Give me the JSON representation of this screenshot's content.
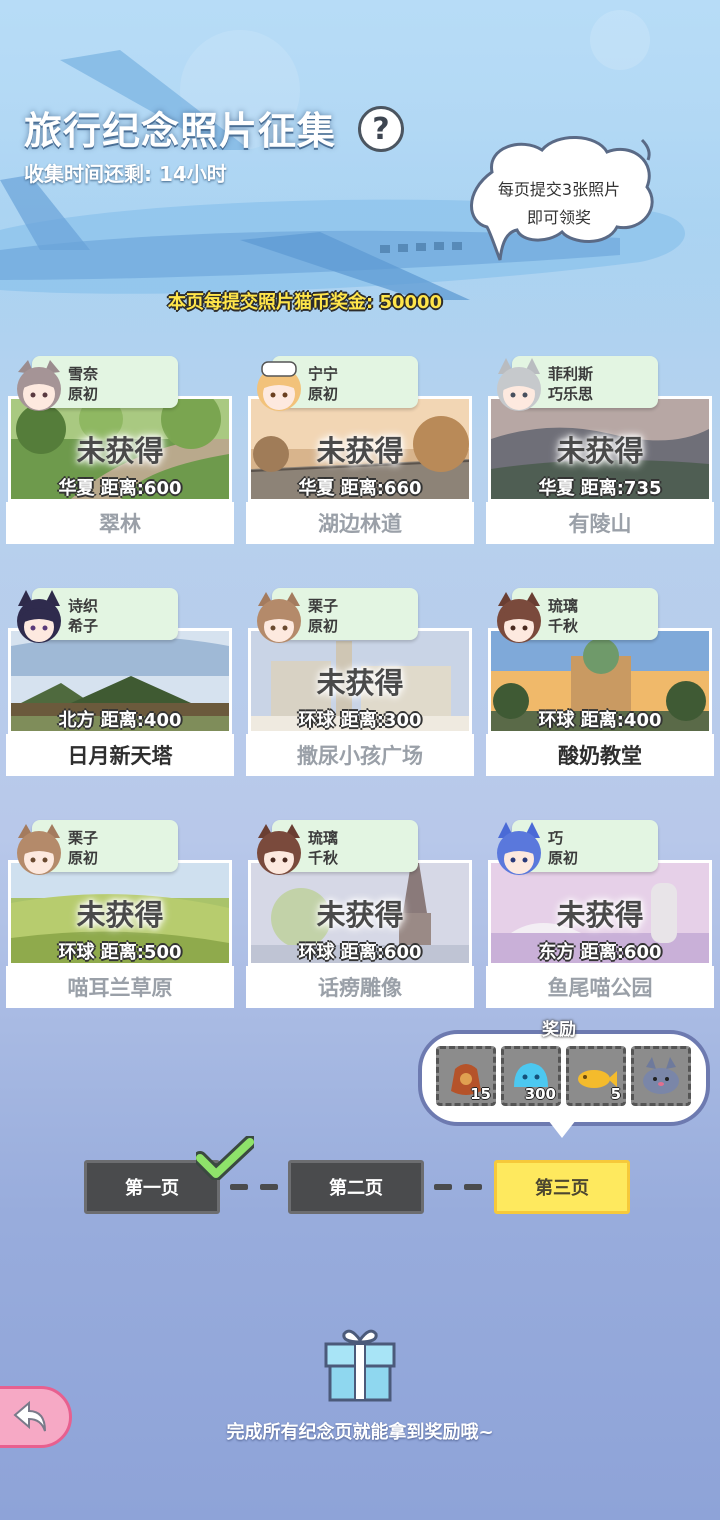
{
  "header": {
    "title": "旅行纪念照片征集",
    "help_symbol": "?",
    "timer": "收集时间还剩: 14小时",
    "bubble_line1": "每页提交3张照片",
    "bubble_line2": "即可领奖",
    "bonus": "本页每提交照片猫币奖金: 50000"
  },
  "cards": [
    {
      "char_line1": "雪奈",
      "char_line2": "原初",
      "status": "未获得",
      "distance": "华夏  距离:600",
      "name": "翠林",
      "name_style": "dim"
    },
    {
      "char_line1": "宁宁",
      "char_line2": "原初",
      "status": "未获得",
      "distance": "华夏  距离:660",
      "name": "湖边林道",
      "name_style": "dim"
    },
    {
      "char_line1": "菲利斯",
      "char_line2": "巧乐思",
      "status": "未获得",
      "distance": "华夏  距离:735",
      "name": "有陵山",
      "name_style": "dim"
    },
    {
      "char_line1": "诗织",
      "char_line2": "希子",
      "status": "",
      "distance": "北方  距离:400",
      "name": "日月新天塔",
      "name_style": "lit"
    },
    {
      "char_line1": "栗子",
      "char_line2": "原初",
      "status": "未获得",
      "distance": "环球  距离:300",
      "name": "撒尿小孩广场",
      "name_style": "dim"
    },
    {
      "char_line1": "琉璃",
      "char_line2": "千秋",
      "status": "",
      "distance": "环球  距离:400",
      "name": "酸奶教堂",
      "name_style": "lit"
    },
    {
      "char_line1": "栗子",
      "char_line2": "原初",
      "status": "未获得",
      "distance": "环球  距离:500",
      "name": "喵耳兰草原",
      "name_style": "dim"
    },
    {
      "char_line1": "琉璃",
      "char_line2": "千秋",
      "status": "未获得",
      "distance": "环球  距离:600",
      "name": "话痨雕像",
      "name_style": "dim"
    },
    {
      "char_line1": "巧",
      "char_line2": "原初",
      "status": "未获得",
      "distance": "东方  距离:600",
      "name": "鱼尾喵公园",
      "name_style": "dim"
    }
  ],
  "rewards": {
    "label": "奖励",
    "items": [
      {
        "icon": "treasure-bag-icon",
        "count": "15"
      },
      {
        "icon": "blue-slime-icon",
        "count": "300"
      },
      {
        "icon": "golden-fish-icon",
        "count": "5"
      },
      {
        "icon": "cat-plush-icon",
        "count": ""
      }
    ]
  },
  "pages": {
    "page1": "第一页",
    "page2": "第二页",
    "page3": "第三页",
    "completed": "page1",
    "current": "page3"
  },
  "footer": {
    "text": "完成所有纪念页就能拿到奖励哦~"
  },
  "colors": {
    "current_page": "#fee95e",
    "page_button": "#4a4b4d",
    "check": "#8ee36a",
    "tag_bg": "#e3f5e2",
    "back_button": "#f6a9c5"
  }
}
